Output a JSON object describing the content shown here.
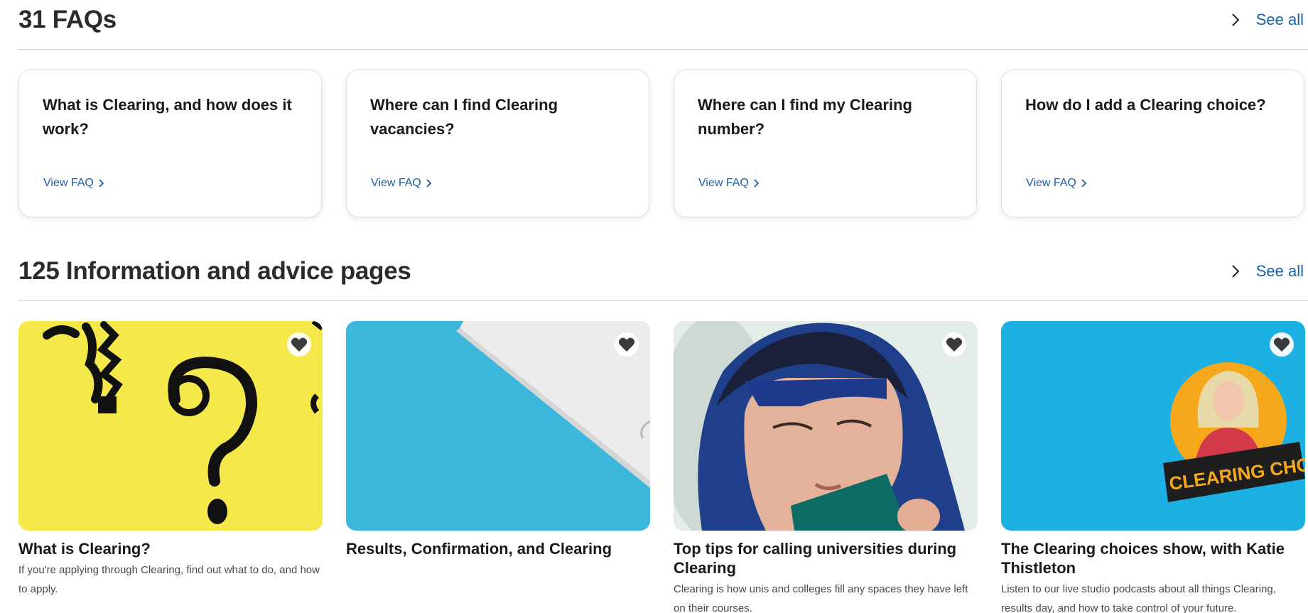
{
  "faqs": {
    "title": "31 FAQs",
    "see_all": "See all",
    "cards": [
      {
        "question": "What is Clearing, and how does it work?",
        "link": "View FAQ"
      },
      {
        "question": "Where can I find Clearing vacancies?",
        "link": "View FAQ"
      },
      {
        "question": "Where can I find my Clearing number?",
        "link": "View FAQ"
      },
      {
        "question": "How do I add a Clearing choice?",
        "link": "View FAQ"
      }
    ]
  },
  "advice": {
    "title": "125 Information and advice pages",
    "see_all": "See all",
    "cards": [
      {
        "title": "What is Clearing?",
        "description": "If you're applying through Clearing, find out what to do, and how to apply.",
        "image": "yellow-question-marks"
      },
      {
        "title": "Results, Confirmation, and Clearing",
        "description": "",
        "image": "blue-paper-corner"
      },
      {
        "title": "Top tips for calling universities during Clearing",
        "description": "Clearing is how unis and colleges fill any spaces they have left on their courses.",
        "image": "person-with-phone"
      },
      {
        "title": "The Clearing choices show, with Katie Thistleton",
        "description": "Listen to our live studio podcasts about all things Clearing, results day, and how to take control of your future.",
        "image": "clearing-choices-podcast",
        "logo_text": "CLEARING CHOICES"
      }
    ]
  },
  "icons": {
    "see_all": "chevron-right-icon",
    "favourite": "heart-icon"
  },
  "colors": {
    "link": "#1b5fa6",
    "heart": "#3a3a3a"
  }
}
